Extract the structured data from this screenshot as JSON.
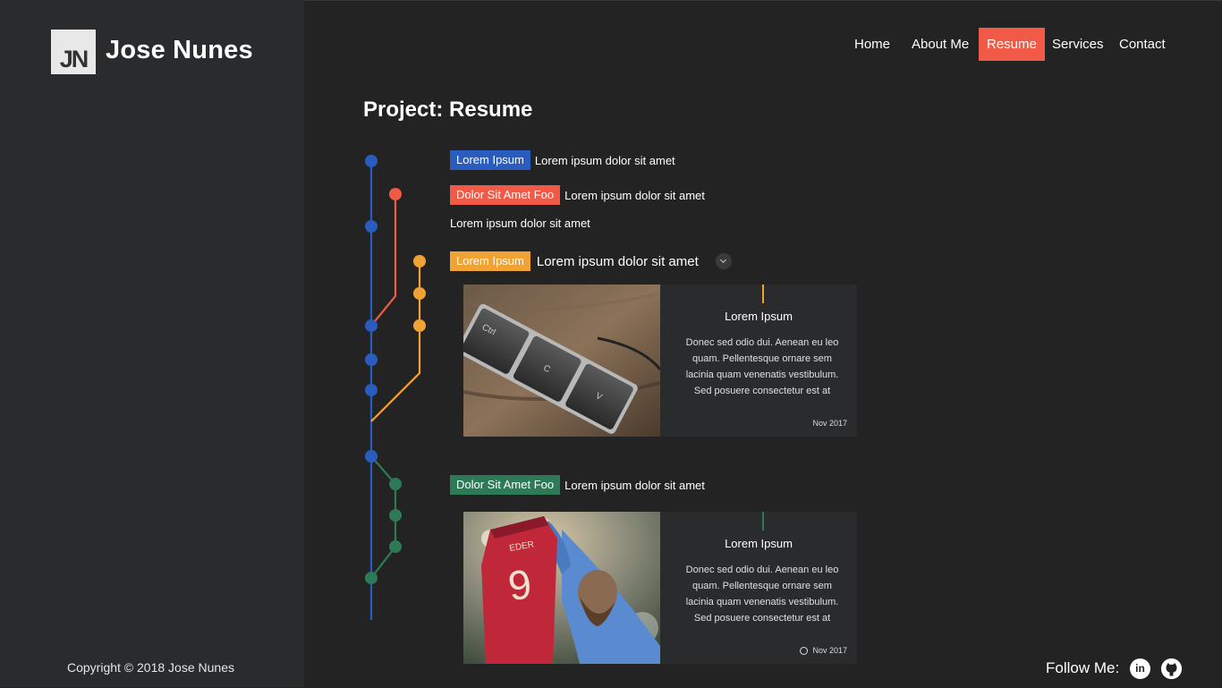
{
  "brand": {
    "logo_initials": "JN",
    "name": "Jose Nunes"
  },
  "footer": {
    "copyright": "Copyright © 2018 Jose Nunes",
    "follow_label": "Follow Me:",
    "social": [
      {
        "icon": "linkedin-icon",
        "glyph": "in"
      },
      {
        "icon": "github-icon",
        "glyph": ""
      }
    ]
  },
  "nav": {
    "items": [
      {
        "label": "Home",
        "active": false
      },
      {
        "label": "About Me",
        "active": false
      },
      {
        "label": "Resume",
        "active": true
      },
      {
        "label": "Services",
        "active": false
      },
      {
        "label": "Contact",
        "active": false
      }
    ]
  },
  "page": {
    "title": "Project: Resume"
  },
  "colors": {
    "blue": "#2a5cc0",
    "red": "#f05a46",
    "orange": "#f0a235",
    "green": "#2e7a56",
    "accent": "#f05a46"
  },
  "timeline": {
    "entries": [
      {
        "tag": "Lorem Ipsum",
        "tag_color": "blue",
        "text": "Lorem ipsum dolor sit amet"
      },
      {
        "tag": "Dolor Sit Amet Foo",
        "tag_color": "red",
        "text": "Lorem ipsum dolor sit amet"
      },
      {
        "tag": "",
        "text": "Lorem ipsum dolor sit amet"
      },
      {
        "tag": "Lorem Ipsum",
        "tag_color": "orange",
        "text": "Lorem ipsum dolor sit amet",
        "expandable": true
      },
      {
        "tag": "Dolor Sit Amet Foo",
        "tag_color": "green",
        "text": "Lorem ipsum dolor sit amet"
      }
    ],
    "cards": [
      {
        "image": "keyboard-keys-image",
        "title": "Lorem Ipsum",
        "description": "Donec sed odio dui. Aenean eu leo quam. Pellentesque ornare sem lacinia quam venenatis vestibulum. Sed posuere consectetur est at",
        "date": "Nov 2017",
        "stem_color": "orange",
        "show_clock": false
      },
      {
        "image": "football-player-jersey-image",
        "title": "Lorem Ipsum",
        "description": "Donec sed odio dui. Aenean eu leo quam. Pellentesque ornare sem lacinia quam venenatis vestibulum. Sed posuere consectetur est at",
        "date": "Nov 2017",
        "stem_color": "green",
        "show_clock": true
      }
    ],
    "jersey_text": "EDER",
    "jersey_number": "9",
    "key_labels": [
      "Ctrl",
      "C",
      "V"
    ]
  }
}
